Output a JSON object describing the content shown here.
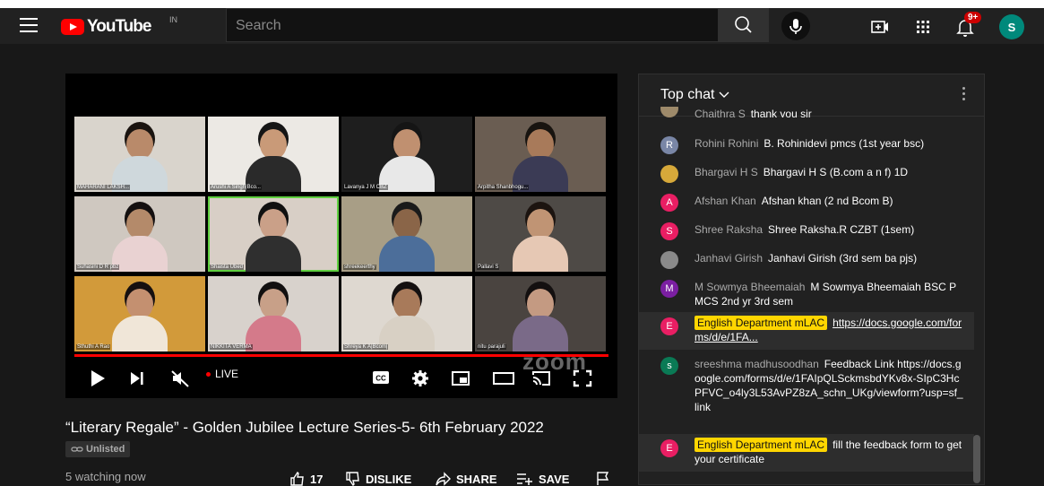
{
  "header": {
    "logo_text": "YouTube",
    "country": "IN",
    "search_placeholder": "Search",
    "notification_count": "9+",
    "avatar_letter": "S"
  },
  "player": {
    "live_label": "LIVE",
    "zoom_watermark": "zoom",
    "participants": [
      {
        "name": "MAHARANI LAKSH...",
        "bg": "#d9d4cc",
        "skin": "#b98a6a",
        "shirt": "#cfd8dc",
        "hair": "#1a1410"
      },
      {
        "name": "Arushi A Singh|Bco...",
        "bg": "#ece9e4",
        "skin": "#c99a78",
        "shirt": "#2a2a2a",
        "hair": "#151515"
      },
      {
        "name": "Lavanya J M CBZ",
        "bg": "#1e1e1e",
        "skin": "#c09070",
        "shirt": "#e8e8e8",
        "hair": "#151515"
      },
      {
        "name": "Arpitha Shanbhogu...",
        "bg": "#6a5d52",
        "skin": "#a87a5a",
        "shirt": "#3b3b55",
        "hair": "#181410"
      },
      {
        "name": "Suhasini D R pbz",
        "bg": "#cfc8c0",
        "skin": "#b48a6a",
        "shirt": "#e9d2d2",
        "hair": "#141010"
      },
      {
        "name": "Shaista Ubed",
        "bg": "#d8cfc6",
        "skin": "#caa088",
        "shirt": "#2f2f2f",
        "hair": "#101010"
      },
      {
        "name": "shreekeerthy",
        "bg": "#a89e86",
        "skin": "#8a6548",
        "shirt": "#4c6e9a",
        "hair": "#1a1a1a"
      },
      {
        "name": "Pallavi S",
        "bg": "#4e4a46",
        "skin": "#c09474",
        "shirt": "#e6c8b4",
        "hair": "#1c1410"
      },
      {
        "name": "Sthuthi A Rao",
        "bg": "#d29a3a",
        "skin": "#c49070",
        "shirt": "#f0e6d8",
        "hair": "#161010"
      },
      {
        "name": "NIKKITA VERMA",
        "bg": "#d8d2cc",
        "skin": "#c8a088",
        "shirt": "#d47a8a",
        "hair": "#121010"
      },
      {
        "name": "Shreya K A|Bcom|",
        "bg": "#ded8d0",
        "skin": "#a87a5a",
        "shirt": "#d8d0c4",
        "hair": "#141010"
      },
      {
        "name": "nitu parajuli",
        "bg": "#4a4440",
        "skin": "#c49a82",
        "shirt": "#7a6a88",
        "hair": "#141010"
      }
    ]
  },
  "video": {
    "title": "“Literary Regale” - Golden Jubilee Lecture Series-5- 6th February 2022",
    "visibility": "Unlisted",
    "watching": "5 watching now",
    "likes": "17",
    "dislike_label": "DISLIKE",
    "share_label": "SHARE",
    "save_label": "SAVE"
  },
  "chat": {
    "title": "Top chat",
    "messages": [
      {
        "author": "Chaithra S",
        "text": "thank you sir",
        "avatar_letter": "",
        "avatar_color": "#9e8a6a",
        "partial": true
      },
      {
        "author": "Rohini Rohini",
        "text": "B. Rohinidevi pmcs (1st year bsc)",
        "avatar_letter": "R",
        "avatar_color": "#7986a6"
      },
      {
        "author": "Bhargavi H S",
        "text": "Bhargavi H S (B.com a n f) 1D",
        "avatar_letter": "",
        "avatar_color": "#d7a93a"
      },
      {
        "author": "Afshan Khan",
        "text": "Afshan khan (2 nd Bcom B)",
        "avatar_letter": "A",
        "avatar_color": "#e91e63"
      },
      {
        "author": "Shree Raksha",
        "text": "Shree Raksha.R CZBT (1sem)",
        "avatar_letter": "S",
        "avatar_color": "#e91e63"
      },
      {
        "author": "Janhavi Girish",
        "text": "Janhavi Girish (3rd sem ba pjs)",
        "avatar_letter": "",
        "avatar_color": "#8a8a8a"
      },
      {
        "author": "M Sowmya Bheemaiah",
        "text": "M Sowmya Bheemaiah BSC PMCS 2nd yr 3rd sem",
        "avatar_letter": "M",
        "avatar_color": "#7b1fa2"
      },
      {
        "author": "English Department mLAC",
        "text": "https://docs.google.com/forms/d/e/1FA...",
        "avatar_letter": "E",
        "avatar_color": "#e91e63",
        "owner": true
      },
      {
        "author": "sreeshma madhusoodhan",
        "text": "Feedback Link https://docs.google.com/forms/d/e/1FAIpQLSckmsbdYKv8x-SIpC3HcPFVC_o4ly3L53AvPZ8zA_schn_UKg/viewform?usp=sf_link",
        "avatar_letter": "s",
        "avatar_color": "#0a7a55"
      },
      {
        "author": "English Department mLAC",
        "text": "fill the feedback form to get your certificate",
        "avatar_letter": "E",
        "avatar_color": "#e91e63",
        "owner": true
      }
    ]
  }
}
